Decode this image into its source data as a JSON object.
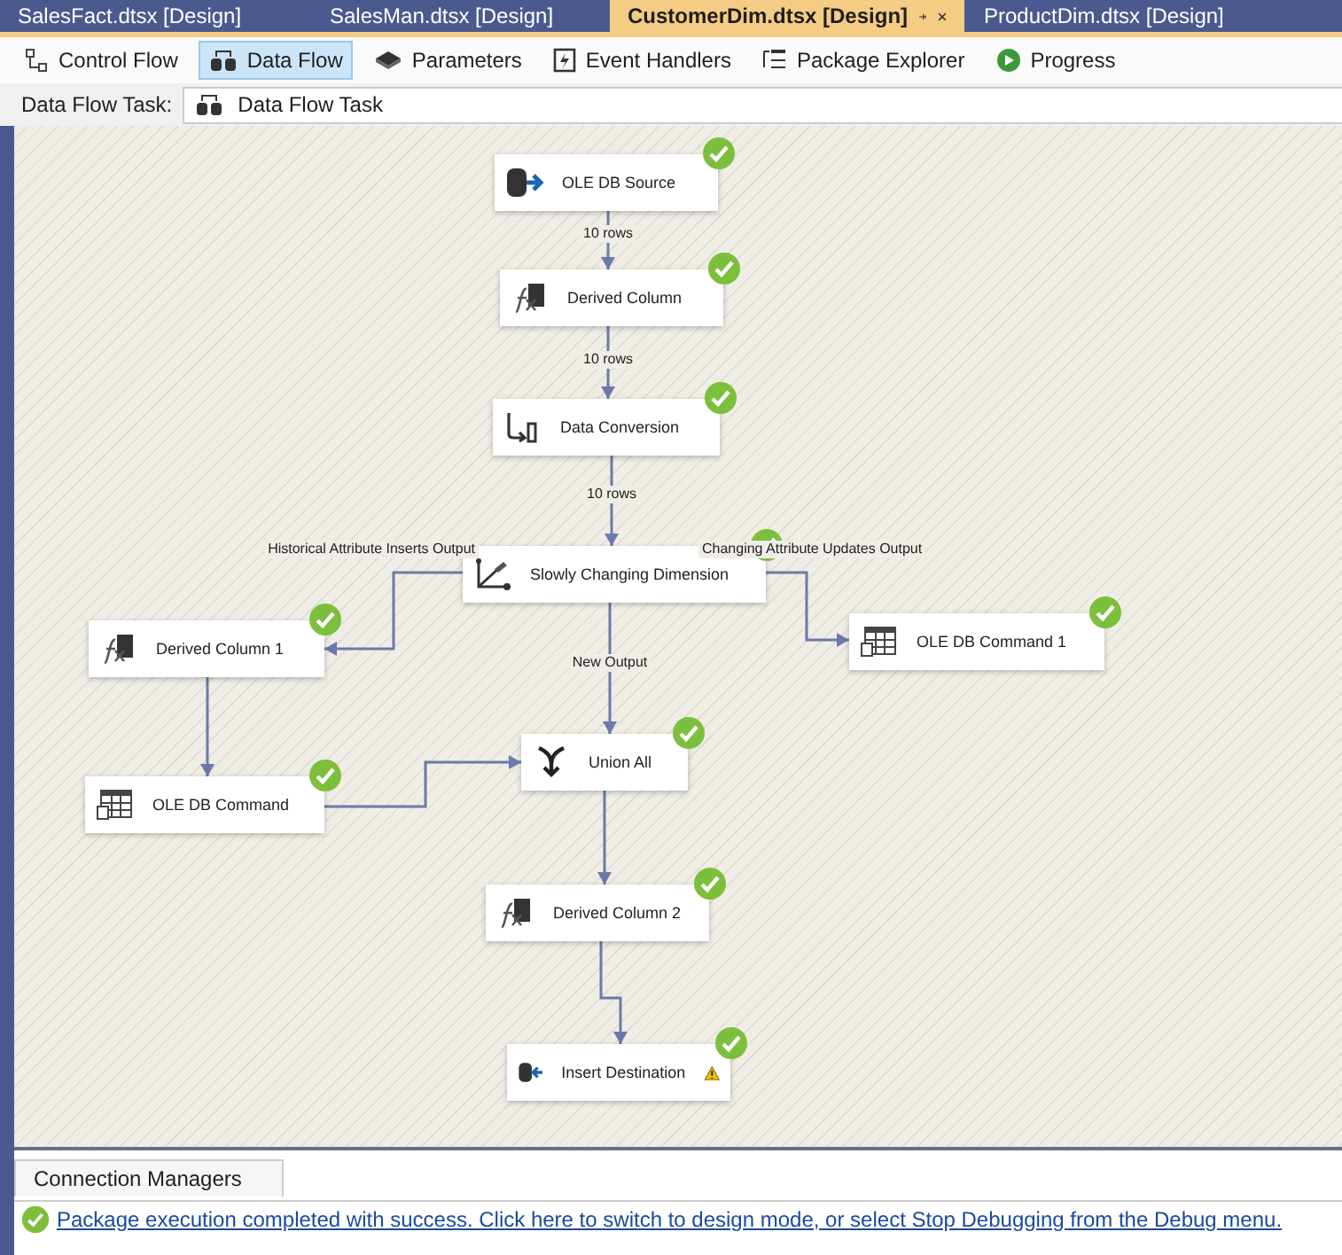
{
  "tabs": [
    {
      "label": "SalesFact.dtsx [Design]",
      "selected": false
    },
    {
      "label": "SalesMan.dtsx [Design]",
      "selected": false
    },
    {
      "label": "CustomerDim.dtsx [Design]",
      "selected": true
    },
    {
      "label": "ProductDim.dtsx [Design]",
      "selected": false
    }
  ],
  "toolbar": [
    {
      "label": "Control Flow",
      "kind": "control-flow",
      "selected": false
    },
    {
      "label": "Data Flow",
      "kind": "data-flow",
      "selected": true
    },
    {
      "label": "Parameters",
      "kind": "parameters",
      "selected": false
    },
    {
      "label": "Event Handlers",
      "kind": "event-handlers",
      "selected": false
    },
    {
      "label": "Package Explorer",
      "kind": "package-explorer",
      "selected": false
    },
    {
      "label": "Progress",
      "kind": "progress",
      "selected": false
    }
  ],
  "task_selector": {
    "label": "Data Flow Task:",
    "value": "Data Flow Task"
  },
  "nodes": [
    {
      "label": "OLE DB Source",
      "kind": "source",
      "success": true,
      "warning": false
    },
    {
      "label": "Derived Column",
      "kind": "derived",
      "success": true,
      "warning": false
    },
    {
      "label": "Data Conversion",
      "kind": "conversion",
      "success": true,
      "warning": false
    },
    {
      "label": "Slowly Changing Dimension",
      "kind": "scd",
      "success": true,
      "warning": false
    },
    {
      "label": "Derived Column 1",
      "kind": "derived",
      "success": true,
      "warning": false
    },
    {
      "label": "OLE DB Command 1",
      "kind": "command",
      "success": true,
      "warning": false
    },
    {
      "label": "Union All",
      "kind": "union",
      "success": true,
      "warning": false
    },
    {
      "label": "OLE DB Command",
      "kind": "command",
      "success": true,
      "warning": false
    },
    {
      "label": "Derived Column 2",
      "kind": "derived",
      "success": true,
      "warning": false
    },
    {
      "label": "Insert Destination",
      "kind": "destination",
      "success": true,
      "warning": true
    }
  ],
  "edges": [
    {
      "label": "10 rows"
    },
    {
      "label": "10 rows"
    },
    {
      "label": "10 rows"
    },
    {
      "label": "Historical Attribute Inserts Output"
    },
    {
      "label": "Changing Attribute Updates Output"
    },
    {
      "label": "New Output"
    }
  ],
  "bottom_tabs": [
    {
      "label": "Connection Managers"
    }
  ],
  "status_bar": {
    "message": "Package execution completed with success. Click here to switch to design mode, or select Stop Debugging from the Debug menu."
  }
}
